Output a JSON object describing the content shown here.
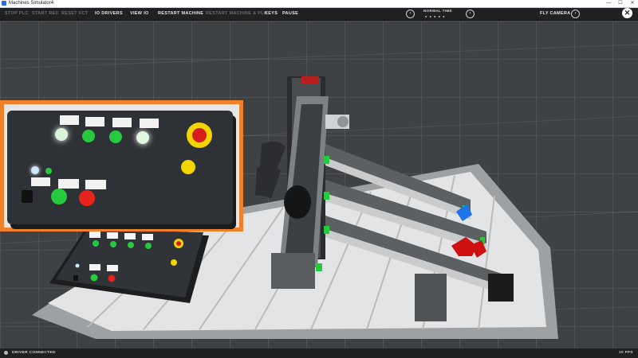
{
  "window": {
    "title": "Machines Simulator4",
    "buttons": [
      "—",
      "☐",
      "✕"
    ]
  },
  "toolbar": {
    "stop_plc": "STOP PLC",
    "start_rec": "START REC",
    "reset_fct": "RESET FCT",
    "io_drivers": "IO DRIVERS",
    "view_io": "VIEW IO",
    "restart_machine": "RESTART MACHINE",
    "restart_machine_plc": "RESTART MACHINE & PLC",
    "keys": "KEYS",
    "pause": "PAUSE",
    "time_label": "NORMAL TIME",
    "time_dots": "● ● ● ● ●",
    "time_prev": "‹",
    "time_next": "›",
    "camera_label": "FLY CAMERA",
    "camera_toggle": "›",
    "close": "✕"
  },
  "status": {
    "driver": "DRIVER CONNECTED",
    "fps": "10 FPS"
  },
  "colors": {
    "accent_orange": "#f0802a",
    "led_green": "#27c93f",
    "button_red": "#e8231a",
    "estop_yellow": "#f4d400"
  }
}
